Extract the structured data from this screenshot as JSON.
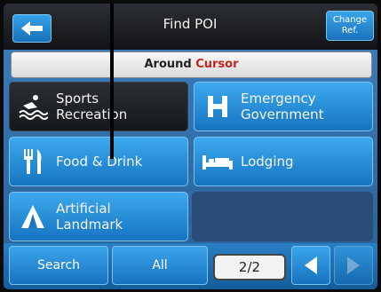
{
  "header": {
    "title": "Find POI",
    "change_label_line1": "Change",
    "change_label_line2": "Ref."
  },
  "around_bar": {
    "label_part1": "Around",
    "label_part2": "Cursor"
  },
  "tiles": [
    {
      "line1": "Sports",
      "line2": "Recreation",
      "icon": "sports-recreation-icon"
    },
    {
      "line1": "Emergency",
      "line2": "Government",
      "icon": "h-hospital-icon"
    },
    {
      "line1": "Food & Drink",
      "icon": "fork-knife-icon"
    },
    {
      "line1": "Lodging",
      "icon": "bed-icon"
    },
    {
      "line1": "Artificial",
      "line2": "Landmark",
      "icon": "landmark-icon"
    }
  ],
  "bottom": {
    "search_label": "Search",
    "all_label": "All",
    "page_indicator": "2/2"
  },
  "colors": {
    "accent_blue": "#1f86d3",
    "cursor_red": "#c2261d"
  }
}
